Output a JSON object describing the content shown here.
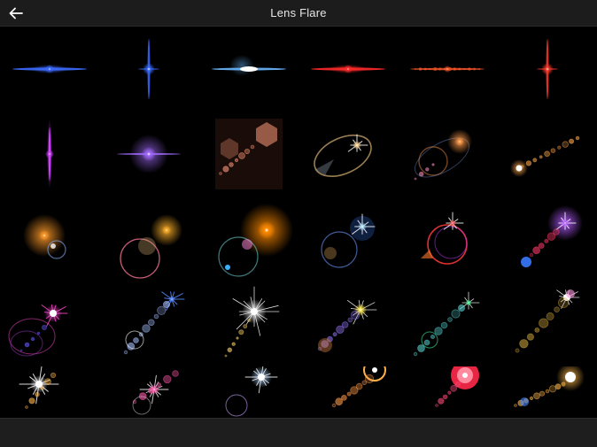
{
  "header": {
    "title": "Lens Flare",
    "back_icon": "arrow-left-icon"
  },
  "flares": [
    {
      "name": "blue-streak",
      "style": "streak",
      "color": "#3d6bff"
    },
    {
      "name": "blue-star",
      "style": "vstar",
      "color": "#3a6bff"
    },
    {
      "name": "anamorphic-blue",
      "style": "anamorphic",
      "color": "#6ab8ff"
    },
    {
      "name": "red-streak",
      "style": "streak",
      "color": "#ff2a2a"
    },
    {
      "name": "red-dotted-streak",
      "style": "dotted",
      "color": "#ff5a2a"
    },
    {
      "name": "red-spike",
      "style": "vstar",
      "color": "#ff3a2a"
    },
    {
      "name": "magenta-spike",
      "style": "vspike",
      "color": "#d040ff"
    },
    {
      "name": "violet-glow",
      "style": "glow",
      "color": "#a36bff"
    },
    {
      "name": "bokeh-hexagons",
      "style": "hex",
      "color": "#ff9a7a"
    },
    {
      "name": "ring-star",
      "style": "ring",
      "color": "#ffd08a"
    },
    {
      "name": "orange-ring-flare",
      "style": "ringflare",
      "color": "#ff9a4a"
    },
    {
      "name": "orange-chain",
      "style": "chain",
      "color": "#ffa84a"
    },
    {
      "name": "orange-burst",
      "style": "burst",
      "color": "#ff9a2a"
    },
    {
      "name": "gold-circle",
      "style": "circle",
      "color": "#ffb02a"
    },
    {
      "name": "sun-circle",
      "style": "sun",
      "color": "#ff8a00"
    },
    {
      "name": "blue-star-ring",
      "style": "bluering",
      "color": "#aee0ff"
    },
    {
      "name": "red-ring-star",
      "style": "redring",
      "color": "#ff4a4a"
    },
    {
      "name": "purple-chain",
      "style": "purplechain",
      "color": "#b25aff"
    },
    {
      "name": "magenta-rings",
      "style": "pinkrings",
      "color": "#ff4ad0"
    },
    {
      "name": "blue-bokeh-chain",
      "style": "bluechain",
      "color": "#5a8aff"
    },
    {
      "name": "white-starburst",
      "style": "starburst",
      "color": "#ffffff"
    },
    {
      "name": "yellow-starburst",
      "style": "ystar",
      "color": "#ffe84a"
    },
    {
      "name": "green-star-chain",
      "style": "greenchain",
      "color": "#2aff8a"
    },
    {
      "name": "pink-star-chain",
      "style": "pinkchain",
      "color": "#ff9adf"
    },
    {
      "name": "white-star-dots",
      "style": "whitestar",
      "color": "#ffffff"
    },
    {
      "name": "pink-starburst",
      "style": "pinkstar",
      "color": "#ff5aaa"
    },
    {
      "name": "blue-white-star",
      "style": "bluestar",
      "color": "#a8d4ff"
    },
    {
      "name": "orange-ring-dots",
      "style": "orangering",
      "color": "#ff9a4a"
    },
    {
      "name": "red-ring-dots",
      "style": "redbokeh",
      "color": "#ff2a4a"
    },
    {
      "name": "gold-ring-dots",
      "style": "goldring",
      "color": "#ffb84a"
    }
  ]
}
